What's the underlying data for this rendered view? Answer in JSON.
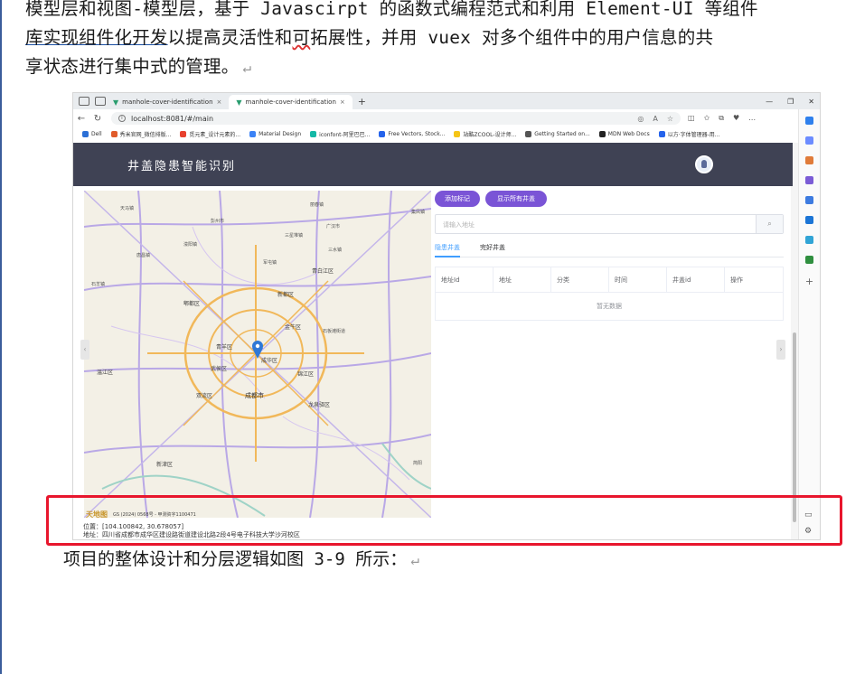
{
  "doc": {
    "para_line1": "模型层和视图-模型层，基于 Javascirpt 的函数式编程范式和利用 Element-UI 等组件",
    "para_line2_a": "库实现组件化开发",
    "para_line2_b": "以提高灵活性和",
    "para_line2_c": "可",
    "para_line2_d": "拓展性，并用 vuex 对多个组件中的用户信息的共",
    "para_line3": "享状态进行集中式的管理。",
    "caption": "项目的整体设计和分层逻辑如图 3-9 所示：",
    "return_mark": "↵"
  },
  "browser": {
    "tabs": [
      {
        "label": "manhole-cover-identification",
        "active": false
      },
      {
        "label": "manhole-cover-identification",
        "active": true
      }
    ],
    "url": "localhost:8081/#/main",
    "bookmarks": [
      {
        "label": "Dell",
        "color": "#2b6fd6"
      },
      {
        "label": "秀米官网_微信排版...",
        "color": "#e05b2a"
      },
      {
        "label": "觅元素_设计元素的...",
        "color": "#e8412e"
      },
      {
        "label": "Material Design",
        "color": "#3b82f6"
      },
      {
        "label": "iconfont-阿里巴巴...",
        "color": "#14b8a6"
      },
      {
        "label": "Free Vectors, Stock...",
        "color": "#2563eb"
      },
      {
        "label": "站酷ZCOOL-设计师...",
        "color": "#f5c518"
      },
      {
        "label": "Getting Started on...",
        "color": "#555555"
      },
      {
        "label": "MDN Web Docs",
        "color": "#222222"
      },
      {
        "label": "以方·字体管理器-用...",
        "color": "#2563eb"
      }
    ]
  },
  "app": {
    "title": "井盖隐患智能识别",
    "buttons": {
      "add_marker": "添加标记",
      "show_all": "显示所有井盖"
    },
    "search_placeholder": "请输入地址",
    "tabs": [
      {
        "label": "隐患井盖",
        "active": true
      },
      {
        "label": "完好井盖",
        "active": false
      }
    ],
    "table": {
      "columns": [
        "地址Id",
        "地址",
        "分类",
        "时间",
        "井盖id",
        "操作"
      ],
      "empty_text": "暂无数据"
    },
    "map": {
      "labels": [
        {
          "text": "天马镇",
          "cls": ""
        },
        {
          "text": "彭州市",
          "cls": ""
        },
        {
          "text": "丽春镇",
          "cls": ""
        },
        {
          "text": "广汉市",
          "cls": ""
        },
        {
          "text": "三星堆镇",
          "cls": ""
        },
        {
          "text": "集凤镇",
          "cls": ""
        },
        {
          "text": "濛阳镇",
          "cls": ""
        },
        {
          "text": "三水镇",
          "cls": ""
        },
        {
          "text": "唐昌镇",
          "cls": ""
        },
        {
          "text": "军屯镇",
          "cls": ""
        },
        {
          "text": "青白江区",
          "cls": "mid"
        },
        {
          "text": "郫都区",
          "cls": "mid"
        },
        {
          "text": "新都区",
          "cls": "mid"
        },
        {
          "text": "石羊镇",
          "cls": ""
        },
        {
          "text": "温江区",
          "cls": "mid"
        },
        {
          "text": "青羊区",
          "cls": "mid"
        },
        {
          "text": "成华区",
          "cls": "mid"
        },
        {
          "text": "金牛区",
          "cls": "mid"
        },
        {
          "text": "武侯区",
          "cls": "mid"
        },
        {
          "text": "锦江区",
          "cls": "mid"
        },
        {
          "text": "双流区",
          "cls": "mid"
        },
        {
          "text": "成都市",
          "cls": "city"
        },
        {
          "text": "龙泉驿区",
          "cls": "mid"
        },
        {
          "text": "新津区",
          "cls": "mid"
        },
        {
          "text": "石板滩街道",
          "cls": ""
        },
        {
          "text": "简阳",
          "cls": ""
        }
      ],
      "footer": "GS (2024) 0568号 - 甲测资字1100471",
      "brand": "天地图",
      "coords_label": "位置：",
      "coords_value": "[104.100842, 30.678057]",
      "address_label": "地址：",
      "address_value": "四川省成都市成华区建设路街道建设北路2段4号电子科技大学沙河校区"
    }
  },
  "colors": {
    "header": "#3f4254",
    "accent_purple": "#7a54d6",
    "tab_blue": "#409eff",
    "highlight_red": "#e8162d"
  }
}
